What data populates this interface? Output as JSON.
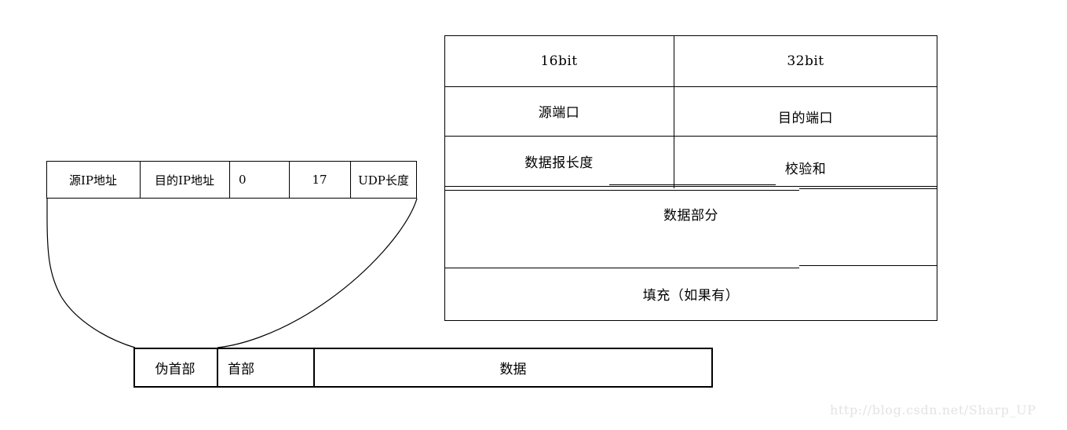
{
  "diagram": {
    "title": "UDP datagram structure with pseudo header",
    "line_color": "#000000",
    "background_color": "#ffffff",
    "watermark": "http://blog.csdn.net/Sharp_UP"
  },
  "udp_table": {
    "bit_headers": {
      "left": "16bit",
      "right": "32bit"
    },
    "rows": [
      {
        "left": "源端口",
        "right": "目的端口"
      },
      {
        "left": "数据报长度",
        "right": "校验和"
      }
    ],
    "data_row": "数据部分",
    "padding_row": "填充（如果有）"
  },
  "pseudo_header": {
    "cells": [
      "源IP地址",
      "目的IP地址",
      "0",
      "17",
      "UDP长度"
    ]
  },
  "bottom_bar": {
    "cells": [
      "伪首部",
      "首部",
      "数据"
    ]
  }
}
